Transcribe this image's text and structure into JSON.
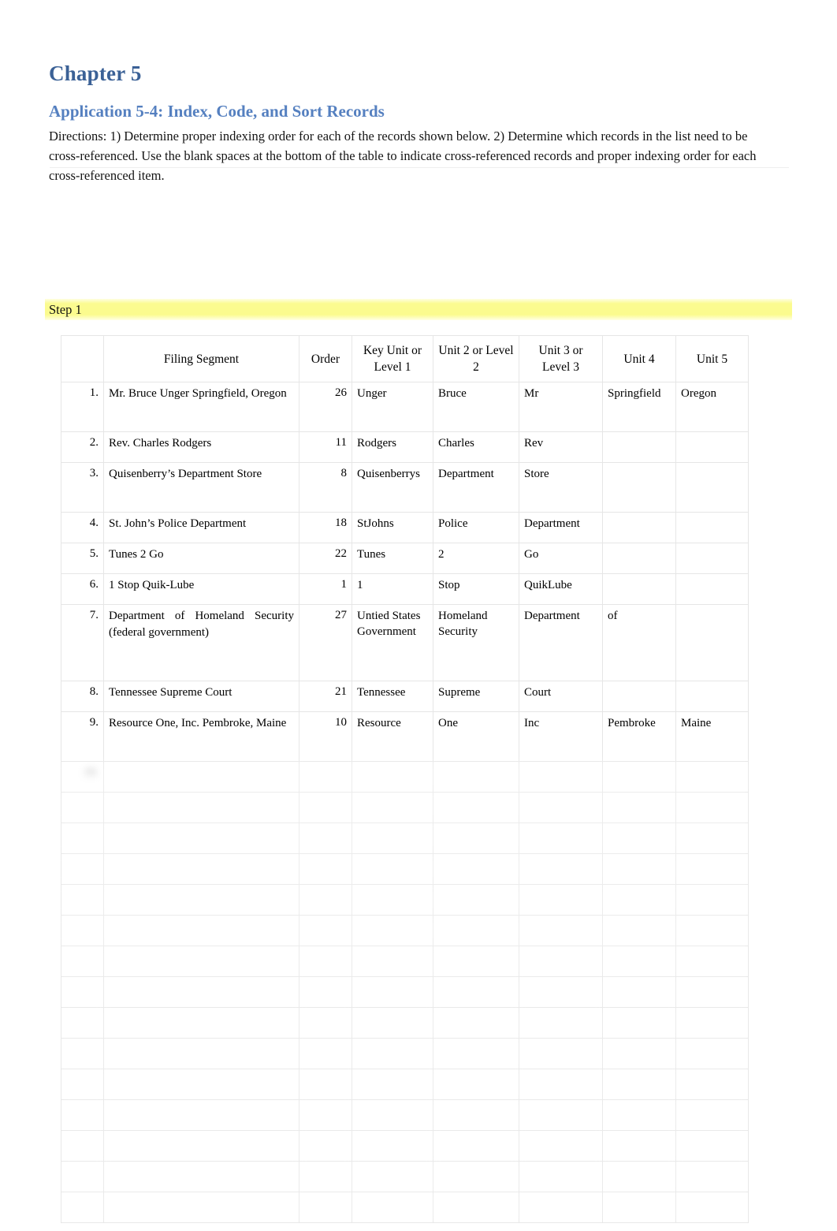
{
  "document": {
    "chapter_title": "Chapter 5",
    "application_title": "Application 5-4: Index, Code, and Sort Records",
    "directions": "Directions:  1) Determine proper indexing order for each of the records shown below. 2) Determine which records in the list need to be cross-referenced. Use the blank spaces at the bottom of the table to indicate cross-referenced records and proper indexing order for each cross-referenced item."
  },
  "step": {
    "label": "Step 1",
    "highlight_color": "#FBFB8D"
  },
  "colors": {
    "heading": "#3B6196",
    "subheading": "#5580C0",
    "table_border": "#E6E6E6",
    "text": "#000000"
  },
  "table": {
    "headers": {
      "number": "",
      "filing_segment": "Filing Segment",
      "order": "Order",
      "key_unit": "Key Unit or Level 1",
      "unit2": "Unit 2 or Level 2",
      "unit3": "Unit 3 or Level 3",
      "unit4": "Unit 4",
      "unit5": "Unit 5"
    },
    "rows": [
      {
        "num": "1.",
        "filing_segment": "Mr. Bruce Unger Springfield, Oregon",
        "order": "26",
        "key_unit": "Unger",
        "unit2": "Bruce",
        "unit3": "Mr",
        "unit4": "Springfield",
        "unit5": "Oregon",
        "blurred": false
      },
      {
        "num": "2.",
        "filing_segment": "Rev. Charles Rodgers",
        "order": "11",
        "key_unit": "Rodgers",
        "unit2": "Charles",
        "unit3": "Rev",
        "unit4": "",
        "unit5": "",
        "blurred": false
      },
      {
        "num": "3.",
        "filing_segment": "Quisenberry’s Department Store",
        "order": "8",
        "key_unit": "Quisenberrys",
        "unit2": "Department",
        "unit3": "Store",
        "unit4": "",
        "unit5": "",
        "blurred": false
      },
      {
        "num": "4.",
        "filing_segment": "St. John’s Police Department",
        "order": "18",
        "key_unit": "StJohns",
        "unit2": "Police",
        "unit3": "Department",
        "unit4": "",
        "unit5": "",
        "blurred": false
      },
      {
        "num": "5.",
        "filing_segment": "Tunes 2 Go",
        "order": "22",
        "key_unit": "Tunes",
        "unit2": "2",
        "unit3": "Go",
        "unit4": "",
        "unit5": "",
        "blurred": false
      },
      {
        "num": "6.",
        "filing_segment": "1 Stop  Quik-Lube",
        "order": "1",
        "key_unit": "1",
        "unit2": "Stop",
        "unit3": "QuikLube",
        "unit4": "",
        "unit5": "",
        "blurred": false
      },
      {
        "num": "7.",
        "filing_segment": "Department of Homeland Security   (federal government)",
        "order": "27",
        "key_unit": "Untied States Government",
        "unit2": "Homeland Security",
        "unit3": "Department",
        "unit4": "of",
        "unit5": "",
        "blurred": false
      },
      {
        "num": "8.",
        "filing_segment": "Tennessee Supreme Court",
        "order": "21",
        "key_unit": "Tennessee",
        "unit2": "Supreme",
        "unit3": "Court",
        "unit4": "",
        "unit5": "",
        "blurred": false
      },
      {
        "num": "9.",
        "filing_segment": "Resource One, Inc. Pembroke, Maine",
        "order": "10",
        "key_unit": "Resource",
        "unit2": "One",
        "unit3": "Inc",
        "unit4": "Pembroke",
        "unit5": "Maine",
        "blurred": false
      },
      {
        "num": "10.",
        "filing_segment": "",
        "order": "",
        "key_unit": "",
        "unit2": "",
        "unit3": "",
        "unit4": "",
        "unit5": "",
        "blurred": true
      },
      {
        "num": "",
        "filing_segment": "",
        "order": "",
        "key_unit": "",
        "unit2": "",
        "unit3": "",
        "unit4": "",
        "unit5": "",
        "blurred": true
      },
      {
        "num": "",
        "filing_segment": "",
        "order": "",
        "key_unit": "",
        "unit2": "",
        "unit3": "",
        "unit4": "",
        "unit5": "",
        "blurred": true
      },
      {
        "num": "",
        "filing_segment": "",
        "order": "",
        "key_unit": "",
        "unit2": "",
        "unit3": "",
        "unit4": "",
        "unit5": "",
        "blurred": true
      },
      {
        "num": "",
        "filing_segment": "",
        "order": "",
        "key_unit": "",
        "unit2": "",
        "unit3": "",
        "unit4": "",
        "unit5": "",
        "blurred": true
      },
      {
        "num": "",
        "filing_segment": "",
        "order": "",
        "key_unit": "",
        "unit2": "",
        "unit3": "",
        "unit4": "",
        "unit5": "",
        "blurred": true
      },
      {
        "num": "",
        "filing_segment": "",
        "order": "",
        "key_unit": "",
        "unit2": "",
        "unit3": "",
        "unit4": "",
        "unit5": "",
        "blurred": true
      },
      {
        "num": "",
        "filing_segment": "",
        "order": "",
        "key_unit": "",
        "unit2": "",
        "unit3": "",
        "unit4": "",
        "unit5": "",
        "blurred": true
      },
      {
        "num": "",
        "filing_segment": "",
        "order": "",
        "key_unit": "",
        "unit2": "",
        "unit3": "",
        "unit4": "",
        "unit5": "",
        "blurred": true
      },
      {
        "num": "",
        "filing_segment": "",
        "order": "",
        "key_unit": "",
        "unit2": "",
        "unit3": "",
        "unit4": "",
        "unit5": "",
        "blurred": true
      },
      {
        "num": "",
        "filing_segment": "",
        "order": "",
        "key_unit": "",
        "unit2": "",
        "unit3": "",
        "unit4": "",
        "unit5": "",
        "blurred": true
      },
      {
        "num": "",
        "filing_segment": "",
        "order": "",
        "key_unit": "",
        "unit2": "",
        "unit3": "",
        "unit4": "",
        "unit5": "",
        "blurred": true
      },
      {
        "num": "",
        "filing_segment": "",
        "order": "",
        "key_unit": "",
        "unit2": "",
        "unit3": "",
        "unit4": "",
        "unit5": "",
        "blurred": true
      },
      {
        "num": "",
        "filing_segment": "",
        "order": "",
        "key_unit": "",
        "unit2": "",
        "unit3": "",
        "unit4": "",
        "unit5": "",
        "blurred": true
      },
      {
        "num": "",
        "filing_segment": "",
        "order": "",
        "key_unit": "",
        "unit2": "",
        "unit3": "",
        "unit4": "",
        "unit5": "",
        "blurred": true
      }
    ]
  },
  "footer": {
    "note": "",
    "page_number": ""
  }
}
